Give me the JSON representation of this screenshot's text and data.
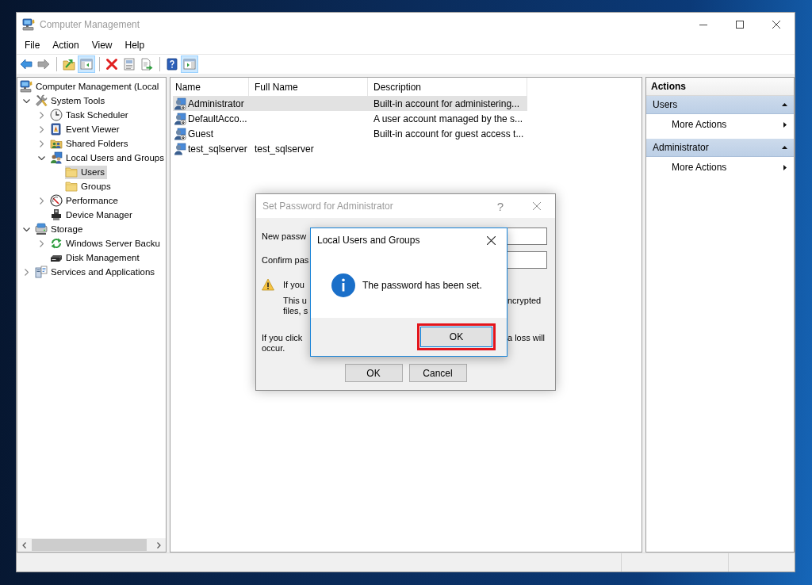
{
  "window": {
    "title": "Computer Management"
  },
  "menu": [
    "File",
    "Action",
    "View",
    "Help"
  ],
  "toolbar": [
    {
      "kind": "button",
      "disabled": false,
      "pressed": false
    },
    {
      "kind": "button",
      "disabled": true,
      "pressed": false
    },
    {
      "kind": "separator"
    },
    {
      "kind": "button",
      "disabled": false,
      "pressed": false
    },
    {
      "kind": "button",
      "disabled": false,
      "pressed": true
    },
    {
      "kind": "separator"
    },
    {
      "kind": "button",
      "disabled": false,
      "pressed": false
    },
    {
      "kind": "button",
      "disabled": false,
      "pressed": false
    },
    {
      "kind": "button",
      "disabled": false,
      "pressed": false
    },
    {
      "kind": "separator"
    },
    {
      "kind": "button",
      "disabled": false,
      "pressed": false
    },
    {
      "kind": "button",
      "disabled": false,
      "pressed": true
    }
  ],
  "tree": [
    {
      "label": "Computer Management (Local",
      "kind": "computer",
      "selected": false,
      "children": [
        {
          "label": "System Tools",
          "kind": "tools",
          "expanded": true,
          "selected": false,
          "children": [
            {
              "label": "Task Scheduler",
              "kind": "scheduler",
              "expanded": false,
              "selected": false
            },
            {
              "label": "Event Viewer",
              "kind": "events",
              "expanded": false,
              "selected": false
            },
            {
              "label": "Shared Folders",
              "kind": "shares",
              "expanded": false,
              "selected": false
            },
            {
              "label": "Local Users and Groups",
              "kind": "accounts",
              "expanded": true,
              "selected": false,
              "children": [
                {
                  "label": "Users",
                  "kind": "folder",
                  "selected": true
                },
                {
                  "label": "Groups",
                  "kind": "folder",
                  "selected": false
                }
              ]
            },
            {
              "label": "Performance",
              "kind": "performance",
              "expanded": false,
              "selected": false
            },
            {
              "label": "Device Manager",
              "kind": "devices",
              "selected": false
            }
          ]
        },
        {
          "label": "Storage",
          "kind": "storage",
          "expanded": true,
          "selected": false,
          "children": [
            {
              "label": "Windows Server Backu",
              "kind": "backup",
              "expanded": false,
              "selected": false
            },
            {
              "label": "Disk Management",
              "kind": "disks",
              "selected": false
            }
          ]
        },
        {
          "label": "Services and Applications",
          "kind": "services",
          "expanded": false,
          "selected": false
        }
      ]
    }
  ],
  "list": {
    "columns": [
      "Name",
      "Full Name",
      "Description"
    ],
    "rows": [
      {
        "name": "Administrator",
        "description": "Built-in account for administering...",
        "selected": true,
        "disabled": true
      },
      {
        "name": "DefaultAcco...",
        "description": "A user account managed by the s...",
        "selected": false,
        "disabled": true
      },
      {
        "name": "Guest",
        "description": "Built-in account for guest access t...",
        "selected": false,
        "disabled": true
      },
      {
        "name": "test_sqlserver",
        "full_name": "test_sqlserver",
        "selected": false,
        "disabled": false
      }
    ]
  },
  "actions": {
    "title": "Actions",
    "sections": [
      {
        "title": "Users",
        "expanded": true,
        "items": [
          "More Actions"
        ]
      },
      {
        "title": "Administrator",
        "expanded": true,
        "items": [
          "More Actions"
        ]
      }
    ]
  },
  "password_dialog": {
    "title": "Set Password for Administrator",
    "help": "?",
    "fields": [
      {
        "label": "New passw"
      },
      {
        "label": "Confirm pas"
      }
    ],
    "warning": {
      "lines": [
        {
          "left": "If you"
        },
        {
          "left": "This u",
          "right": "ncrypted"
        },
        {
          "left": "files, s"
        }
      ]
    },
    "note": {
      "lines": [
        {
          "left": "If you click",
          "right": "a loss will"
        },
        {
          "left": "occur."
        }
      ]
    },
    "buttons": [
      "OK",
      "Cancel"
    ]
  },
  "message_box": {
    "title": "Local Users and Groups",
    "message": "The password has been set.",
    "button": "OK",
    "highlighted": true
  }
}
